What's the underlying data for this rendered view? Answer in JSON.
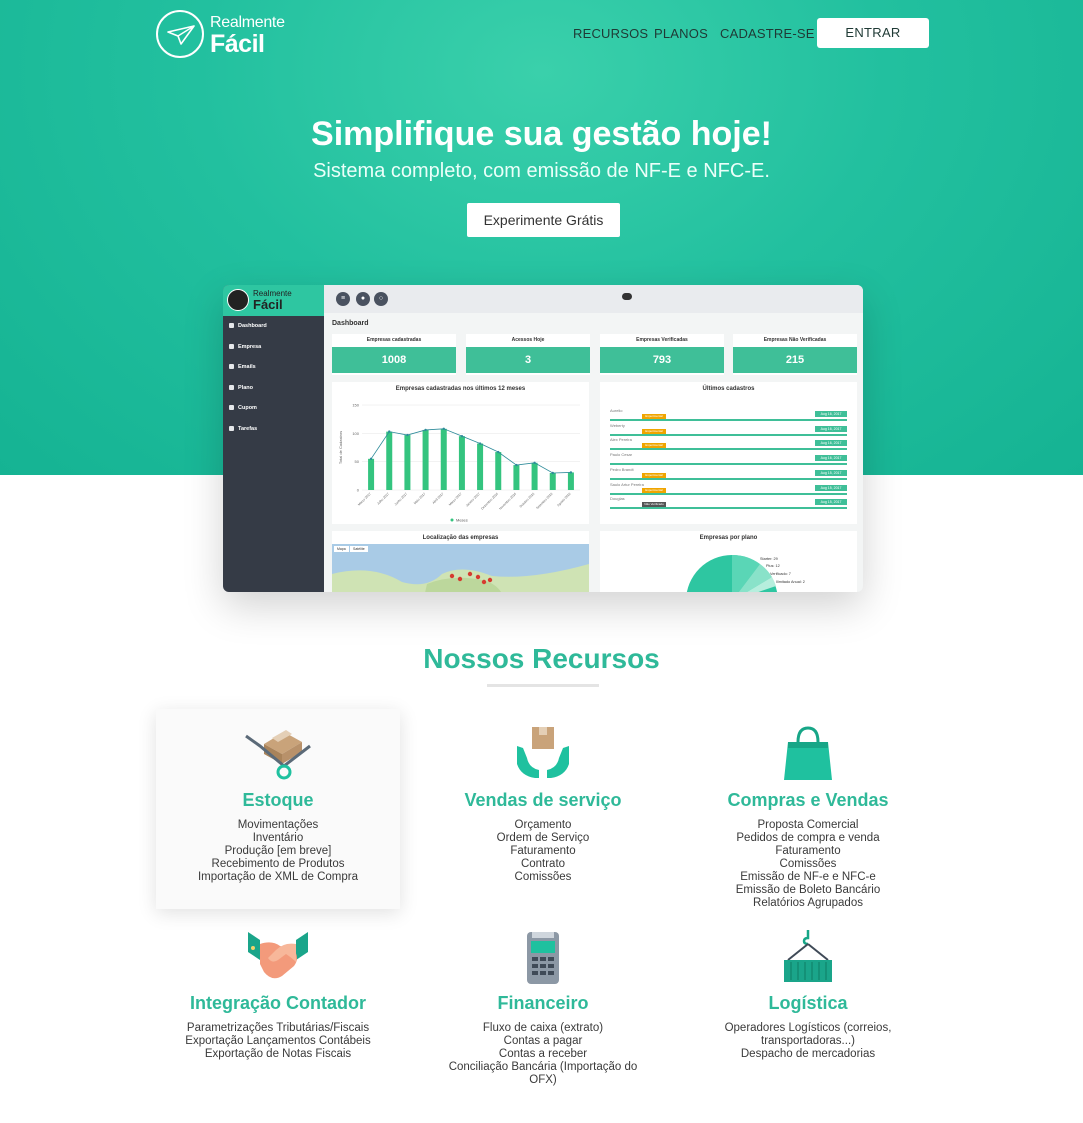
{
  "brand": {
    "line1": "Realmente",
    "line2": "Fácil"
  },
  "nav": {
    "recursos": "RECURSOS",
    "planos": "PLANOS",
    "cadastre": "CADASTRE-SE",
    "entrar": "ENTRAR"
  },
  "hero": {
    "title": "Simplifique sua gestão hoje!",
    "subtitle": "Sistema completo, com emissão de NF-E e NFC-E.",
    "cta": "Experimente Grátis"
  },
  "dashboard": {
    "brand1": "Realmente",
    "brand2": "Fácil",
    "menu": [
      "Dashboard",
      "Empresa",
      "Emails",
      "Plano",
      "Cupom",
      "Tarefas"
    ],
    "title": "Dashboard",
    "stats": [
      {
        "label": "Empresas cadastradas",
        "value": "1008"
      },
      {
        "label": "Acessos Hoje",
        "value": "3"
      },
      {
        "label": "Empresas Verificadas",
        "value": "793"
      },
      {
        "label": "Empresas Não Verificadas",
        "value": "215"
      }
    ],
    "chart_title": "Empresas cadastradas nos últimos 12 meses",
    "chart_legend": "Meses",
    "ultimos_title": "Últimos cadastros",
    "ultimos": [
      {
        "name": "Aurelio",
        "tag": "Experimental",
        "date": "Aug 16, 2017"
      },
      {
        "name": "Weberty",
        "tag": "Experimental",
        "date": "Aug 16, 2017"
      },
      {
        "name": "Alex Pereira",
        "tag": "Experimental",
        "date": "Aug 16, 2017"
      },
      {
        "name": "Paulo Cesar",
        "tag": "",
        "date": "Aug 16, 2017"
      },
      {
        "name": "Pedro Brandt",
        "tag": "Experimental",
        "date": "Aug 15, 2017"
      },
      {
        "name": "Saulo Artur Pereira",
        "tag": "Experimental",
        "date": "Aug 15, 2017"
      },
      {
        "name": "Douglas",
        "tag": "Não Verificado",
        "date": "Aug 15, 2017"
      }
    ],
    "map_title": "Localização das empresas",
    "map_tabs": [
      "Mapa",
      "Satélite"
    ],
    "plano_title": "Empresas por plano",
    "plano_labels": [
      "Starter: 29",
      "Plus: 12",
      "Verificado: 7",
      "Ilimitado Anual: 2"
    ]
  },
  "chart_data": {
    "type": "bar",
    "title": "Empresas cadastradas nos últimos 12 meses",
    "ylabel": "Total de Cadastros",
    "categories": [
      "Março 2017",
      "Julho 2017",
      "Junho 2017",
      "Maio 2017",
      "Abril 2017",
      "Março 2017",
      "Janeiro 2017",
      "Dezembro 2016",
      "Novembro 2016",
      "Outubro 2016",
      "Setembro 2016",
      "Agosto 2016"
    ],
    "values": [
      55,
      103,
      97,
      106,
      108,
      95,
      82,
      67,
      44,
      48,
      30,
      31
    ],
    "ylim": [
      0,
      150
    ],
    "yticks": [
      0,
      50,
      100,
      150
    ],
    "legend": "Meses"
  },
  "features": {
    "title": "Nossos Recursos",
    "items": [
      {
        "name": "Estoque",
        "lines": [
          "Movimentações",
          "Inventário",
          "Produção [em breve]",
          "Recebimento de Produtos",
          "Importação de XML de Compra"
        ]
      },
      {
        "name": "Vendas de serviço",
        "lines": [
          "Orçamento",
          "Ordem de Serviço",
          "Faturamento",
          "Contrato",
          "Comissões"
        ]
      },
      {
        "name": "Compras e Vendas",
        "lines": [
          "Proposta Comercial",
          "Pedidos de compra e venda",
          "Faturamento",
          "Comissões",
          "Emissão de NF-e e NFC-e",
          "Emissão de Boleto Bancário",
          "Relatórios Agrupados"
        ]
      },
      {
        "name": "Integração Contador",
        "lines": [
          "Parametrizações Tributárias/Fiscais",
          "Exportação Lançamentos Contábeis",
          "Exportação de Notas Fiscais"
        ]
      },
      {
        "name": "Financeiro",
        "lines": [
          "Fluxo de caixa (extrato)",
          "Contas a pagar",
          "Contas a receber",
          "Conciliação Bancária (Importação do",
          "OFX)"
        ]
      },
      {
        "name": "Logística",
        "lines": [
          "Operadores Logísticos (correios,",
          "transportadoras...)",
          "Despacho de mercadorias"
        ]
      }
    ]
  },
  "colors": {
    "brand": "#1fc19f",
    "heading": "#2fb999",
    "stat": "#3fbf98",
    "sidebar": "#353b46"
  },
  "icons": [
    "dolly-box-icon",
    "hands-box-icon",
    "shopping-bag-icon",
    "handshake-icon",
    "card-machine-icon",
    "container-crane-icon"
  ]
}
